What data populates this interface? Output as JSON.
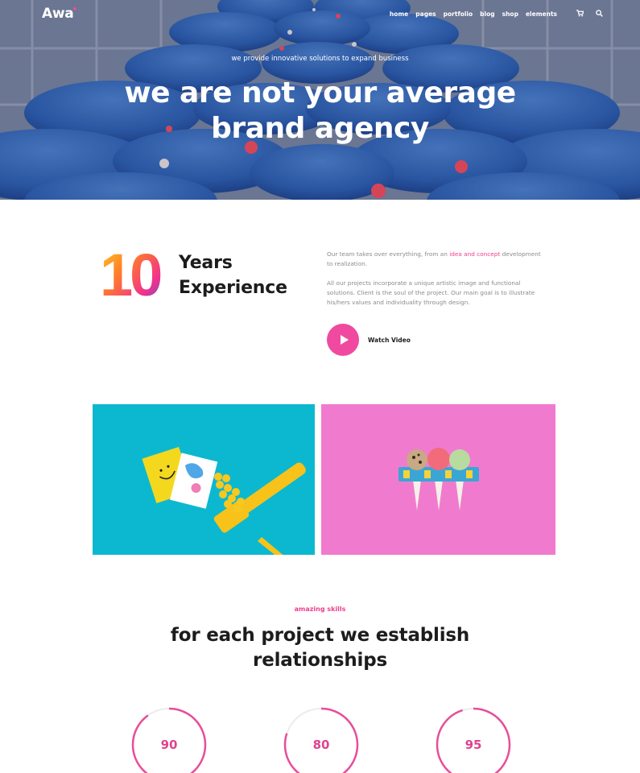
{
  "header": {
    "logo": "Awa",
    "nav": [
      {
        "label": "home",
        "active": false
      },
      {
        "label": "pages",
        "active": true
      },
      {
        "label": "portfolio",
        "active": false
      },
      {
        "label": "blog",
        "active": false
      },
      {
        "label": "shop",
        "active": false
      },
      {
        "label": "elements",
        "active": false
      }
    ],
    "icons": [
      "cart-icon",
      "search-icon"
    ]
  },
  "hero": {
    "subtitle": "we provide innovative solutions to expand business",
    "title_line1": "we are not your average",
    "title_line2": "brand agency"
  },
  "experience": {
    "number": "10",
    "label_line1": "Years",
    "label_line2": "Experience",
    "para1_before": "Our team takes over everything, from an ",
    "para1_highlight": "idea and concept",
    "para1_after": " development to realization.",
    "para2": "All our projects incorporate a unique artistic image and functional solutions. Client is the soul of the project. Our main goal is to illustrate his/hers values and individuality through design.",
    "watch_label": "Watch Video"
  },
  "portfolio": {
    "tiles": [
      {
        "color": "#0cb8d0",
        "icon": "business-cards-brush-image"
      },
      {
        "color": "#f07bce",
        "icon": "ice-cream-cones-image"
      }
    ]
  },
  "skills": {
    "kicker": "amazing skills",
    "title_line1": "for each project we establish",
    "title_line2": "relationships",
    "items": [
      {
        "value": 90
      },
      {
        "value": 80
      },
      {
        "value": 95
      }
    ]
  },
  "colors": {
    "accent_pink": "#ef3f8f",
    "nav_underline": "#f5c518",
    "ring_pink": "#e84d9a"
  }
}
